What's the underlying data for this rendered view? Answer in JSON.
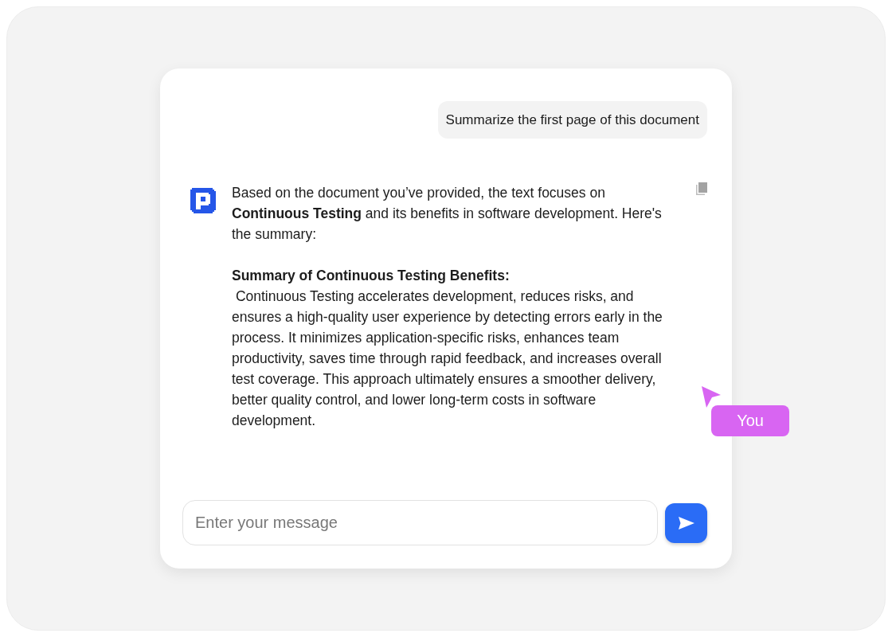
{
  "conversation": {
    "messages": [
      {
        "kind": "user",
        "text": "Summarize the first page of this document"
      },
      {
        "kind": "assistant",
        "paragraphs": [
          {
            "kind": "text",
            "text": "Based on the document you’ve provided, the text focuses on **Continuous Testing** and its benefits in software development. Here's the summary:"
          },
          {
            "kind": "heading",
            "text": "Summary of Continuous Testing Benefits:"
          },
          {
            "kind": "body",
            "text": " Continuous Testing accelerates development, reduces risks, and ensures a high-quality user experience by detecting errors early in the process. It minimizes application-specific risks, enhances team productivity, saves time through rapid feedback, and increases overall test coverage. This approach ultimately ensures a smoother delivery, better quality control, and lower long-term costs in software development."
          }
        ]
      }
    ]
  },
  "composer": {
    "placeholder": "Enter your message"
  },
  "cursor": {
    "label": "You"
  }
}
